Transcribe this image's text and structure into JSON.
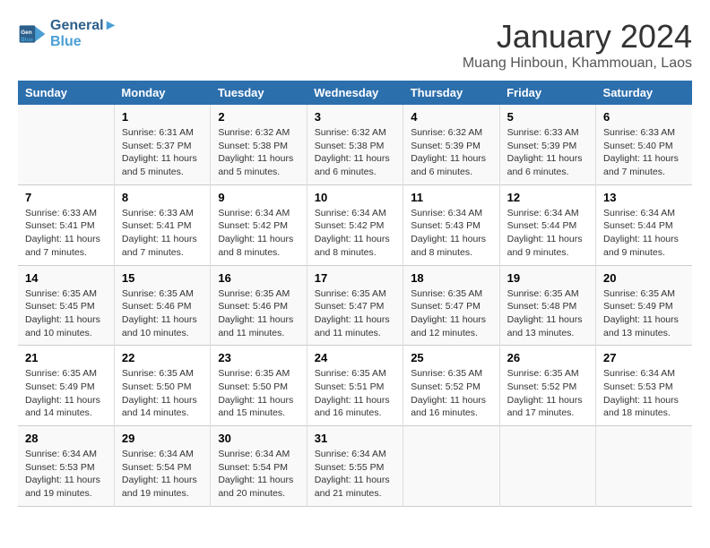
{
  "header": {
    "logo_line1": "General",
    "logo_line2": "Blue",
    "title": "January 2024",
    "subtitle": "Muang Hinboun, Khammouan, Laos"
  },
  "weekdays": [
    "Sunday",
    "Monday",
    "Tuesday",
    "Wednesday",
    "Thursday",
    "Friday",
    "Saturday"
  ],
  "weeks": [
    [
      {
        "day": "",
        "info": ""
      },
      {
        "day": "1",
        "info": "Sunrise: 6:31 AM\nSunset: 5:37 PM\nDaylight: 11 hours\nand 5 minutes."
      },
      {
        "day": "2",
        "info": "Sunrise: 6:32 AM\nSunset: 5:38 PM\nDaylight: 11 hours\nand 5 minutes."
      },
      {
        "day": "3",
        "info": "Sunrise: 6:32 AM\nSunset: 5:38 PM\nDaylight: 11 hours\nand 6 minutes."
      },
      {
        "day": "4",
        "info": "Sunrise: 6:32 AM\nSunset: 5:39 PM\nDaylight: 11 hours\nand 6 minutes."
      },
      {
        "day": "5",
        "info": "Sunrise: 6:33 AM\nSunset: 5:39 PM\nDaylight: 11 hours\nand 6 minutes."
      },
      {
        "day": "6",
        "info": "Sunrise: 6:33 AM\nSunset: 5:40 PM\nDaylight: 11 hours\nand 7 minutes."
      }
    ],
    [
      {
        "day": "7",
        "info": "Sunrise: 6:33 AM\nSunset: 5:41 PM\nDaylight: 11 hours\nand 7 minutes."
      },
      {
        "day": "8",
        "info": "Sunrise: 6:33 AM\nSunset: 5:41 PM\nDaylight: 11 hours\nand 7 minutes."
      },
      {
        "day": "9",
        "info": "Sunrise: 6:34 AM\nSunset: 5:42 PM\nDaylight: 11 hours\nand 8 minutes."
      },
      {
        "day": "10",
        "info": "Sunrise: 6:34 AM\nSunset: 5:42 PM\nDaylight: 11 hours\nand 8 minutes."
      },
      {
        "day": "11",
        "info": "Sunrise: 6:34 AM\nSunset: 5:43 PM\nDaylight: 11 hours\nand 8 minutes."
      },
      {
        "day": "12",
        "info": "Sunrise: 6:34 AM\nSunset: 5:44 PM\nDaylight: 11 hours\nand 9 minutes."
      },
      {
        "day": "13",
        "info": "Sunrise: 6:34 AM\nSunset: 5:44 PM\nDaylight: 11 hours\nand 9 minutes."
      }
    ],
    [
      {
        "day": "14",
        "info": "Sunrise: 6:35 AM\nSunset: 5:45 PM\nDaylight: 11 hours\nand 10 minutes."
      },
      {
        "day": "15",
        "info": "Sunrise: 6:35 AM\nSunset: 5:46 PM\nDaylight: 11 hours\nand 10 minutes."
      },
      {
        "day": "16",
        "info": "Sunrise: 6:35 AM\nSunset: 5:46 PM\nDaylight: 11 hours\nand 11 minutes."
      },
      {
        "day": "17",
        "info": "Sunrise: 6:35 AM\nSunset: 5:47 PM\nDaylight: 11 hours\nand 11 minutes."
      },
      {
        "day": "18",
        "info": "Sunrise: 6:35 AM\nSunset: 5:47 PM\nDaylight: 11 hours\nand 12 minutes."
      },
      {
        "day": "19",
        "info": "Sunrise: 6:35 AM\nSunset: 5:48 PM\nDaylight: 11 hours\nand 13 minutes."
      },
      {
        "day": "20",
        "info": "Sunrise: 6:35 AM\nSunset: 5:49 PM\nDaylight: 11 hours\nand 13 minutes."
      }
    ],
    [
      {
        "day": "21",
        "info": "Sunrise: 6:35 AM\nSunset: 5:49 PM\nDaylight: 11 hours\nand 14 minutes."
      },
      {
        "day": "22",
        "info": "Sunrise: 6:35 AM\nSunset: 5:50 PM\nDaylight: 11 hours\nand 14 minutes."
      },
      {
        "day": "23",
        "info": "Sunrise: 6:35 AM\nSunset: 5:50 PM\nDaylight: 11 hours\nand 15 minutes."
      },
      {
        "day": "24",
        "info": "Sunrise: 6:35 AM\nSunset: 5:51 PM\nDaylight: 11 hours\nand 16 minutes."
      },
      {
        "day": "25",
        "info": "Sunrise: 6:35 AM\nSunset: 5:52 PM\nDaylight: 11 hours\nand 16 minutes."
      },
      {
        "day": "26",
        "info": "Sunrise: 6:35 AM\nSunset: 5:52 PM\nDaylight: 11 hours\nand 17 minutes."
      },
      {
        "day": "27",
        "info": "Sunrise: 6:34 AM\nSunset: 5:53 PM\nDaylight: 11 hours\nand 18 minutes."
      }
    ],
    [
      {
        "day": "28",
        "info": "Sunrise: 6:34 AM\nSunset: 5:53 PM\nDaylight: 11 hours\nand 19 minutes."
      },
      {
        "day": "29",
        "info": "Sunrise: 6:34 AM\nSunset: 5:54 PM\nDaylight: 11 hours\nand 19 minutes."
      },
      {
        "day": "30",
        "info": "Sunrise: 6:34 AM\nSunset: 5:54 PM\nDaylight: 11 hours\nand 20 minutes."
      },
      {
        "day": "31",
        "info": "Sunrise: 6:34 AM\nSunset: 5:55 PM\nDaylight: 11 hours\nand 21 minutes."
      },
      {
        "day": "",
        "info": ""
      },
      {
        "day": "",
        "info": ""
      },
      {
        "day": "",
        "info": ""
      }
    ]
  ]
}
